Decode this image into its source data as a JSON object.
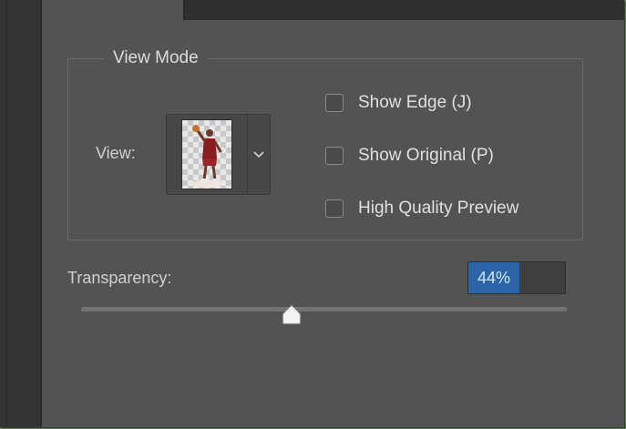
{
  "view_mode": {
    "title": "View Mode",
    "view_label": "View:",
    "checkboxes": [
      {
        "label": "Show Edge (J)",
        "checked": false
      },
      {
        "label": "Show Original (P)",
        "checked": false
      },
      {
        "label": "High Quality Preview",
        "checked": false
      }
    ]
  },
  "transparency": {
    "label": "Transparency:",
    "value": "44%",
    "fraction": 0.44
  },
  "colors": {
    "panel": "#535353",
    "selection": "#2c64a8",
    "frame_accent": "#5a7a44"
  },
  "icons": [
    "chevron-down-icon",
    "slider-thumb-icon"
  ]
}
